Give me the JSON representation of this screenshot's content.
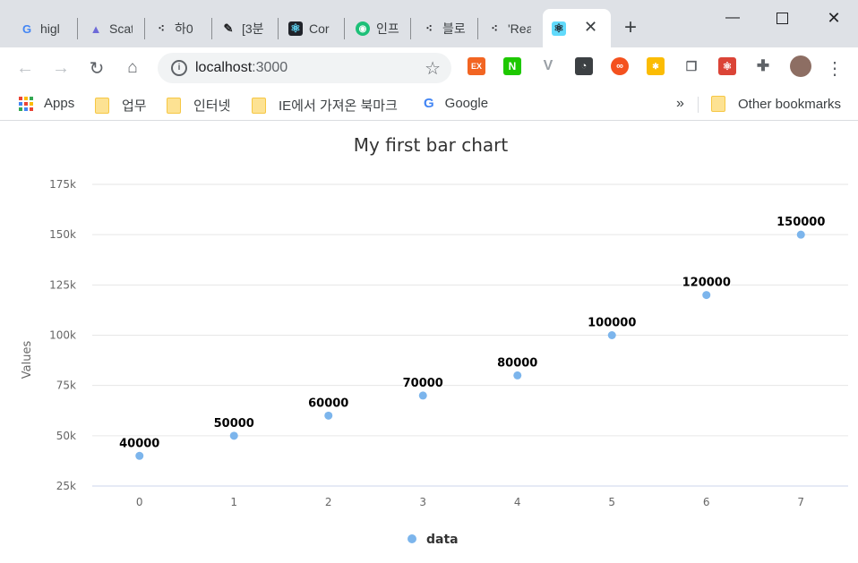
{
  "browser": {
    "tabs": [
      {
        "label": "higl"
      },
      {
        "label": "Scat"
      },
      {
        "label": "하0"
      },
      {
        "label": "[3분"
      },
      {
        "label": "Cor"
      },
      {
        "label": "인프"
      },
      {
        "label": "블로"
      },
      {
        "label": "'Rea"
      }
    ],
    "url_host": "localhost",
    "url_path": ":3000",
    "bookmarks": [
      {
        "label": "Apps"
      },
      {
        "label": "업무"
      },
      {
        "label": "인터넷"
      },
      {
        "label": "IE에서 가져온 북마크"
      },
      {
        "label": "Google"
      }
    ],
    "more_bookmarks": "»",
    "other_bookmarks": "Other bookmarks"
  },
  "colors": {
    "accent": "#7cb5ec",
    "tabstrip": "#dee1e6",
    "grid": "#e6e6e6",
    "axis_line": "#ccd6eb",
    "title": "#333333",
    "tick_label": "#666666"
  },
  "chart_data": {
    "type": "scatter",
    "title": "My first bar chart",
    "ylabel": "Values",
    "xlabel": "",
    "x": [
      0,
      1,
      2,
      3,
      4,
      5,
      6,
      7
    ],
    "series": [
      {
        "name": "data",
        "values": [
          40000,
          50000,
          60000,
          70000,
          80000,
          100000,
          120000,
          150000
        ]
      }
    ],
    "data_labels": [
      "40000",
      "50000",
      "60000",
      "70000",
      "80000",
      "100000",
      "120000",
      "150000"
    ],
    "ylim": [
      25000,
      175000
    ],
    "y_ticks": [
      25000,
      50000,
      75000,
      100000,
      125000,
      150000,
      175000
    ],
    "y_tick_labels": [
      "25k",
      "50k",
      "75k",
      "100k",
      "125k",
      "150k",
      "175k"
    ],
    "x_tick_labels": [
      "0",
      "1",
      "2",
      "3",
      "4",
      "5",
      "6",
      "7"
    ],
    "grid": true,
    "legend": "bottom-center"
  }
}
